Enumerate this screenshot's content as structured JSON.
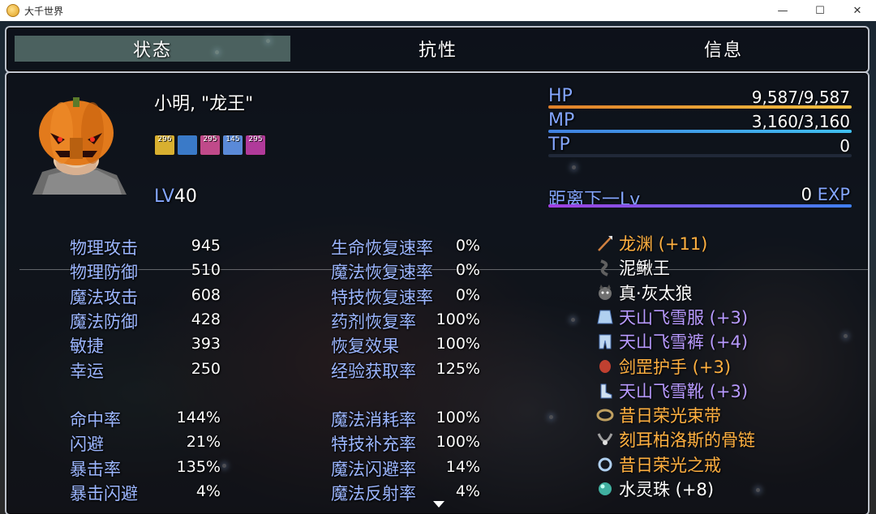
{
  "window": {
    "title": "大千世界"
  },
  "tabs": [
    {
      "label": "状态"
    },
    {
      "label": "抗性"
    },
    {
      "label": "信息"
    }
  ],
  "actor": {
    "name": "小明, \"龙王\"",
    "level_label": "LV",
    "level": "40",
    "states": [
      {
        "icon": "gold-state-icon",
        "turns": "296",
        "color": "#d8b030"
      },
      {
        "icon": "dragon-state-icon",
        "turns": "",
        "color": "#3a7ac8"
      },
      {
        "icon": "pink-state-icon",
        "turns": "295",
        "color": "#c04a8a"
      },
      {
        "icon": "blue-state-icon",
        "turns": "145",
        "color": "#5a8ad8"
      },
      {
        "icon": "magenta-state-icon",
        "turns": "295",
        "color": "#b03a9a"
      }
    ]
  },
  "gauges": {
    "hp": {
      "label": "HP",
      "value": "9,587/9,587",
      "fraction": 1.0,
      "colors": [
        "#e0802a",
        "#f0c040"
      ]
    },
    "mp": {
      "label": "MP",
      "value": "3,160/3,160",
      "fraction": 1.0,
      "colors": [
        "#4080e0",
        "#40c0f0"
      ]
    },
    "tp": {
      "label": "TP",
      "value": "0",
      "fraction": 0.0,
      "colors": [
        "#40c040",
        "#a0f040"
      ]
    },
    "exp": {
      "label": "距离下一Lv",
      "value": "0",
      "unit": "EXP",
      "fraction": 1.0,
      "colors": [
        "#a040e0",
        "#4080f0"
      ]
    }
  },
  "params": [
    {
      "label": "物理攻击",
      "value": "945"
    },
    {
      "label": "物理防御",
      "value": "510"
    },
    {
      "label": "魔法攻击",
      "value": "608"
    },
    {
      "label": "魔法防御",
      "value": "428"
    },
    {
      "label": "敏捷",
      "value": "393"
    },
    {
      "label": "幸运",
      "value": "250"
    }
  ],
  "xparams": [
    {
      "label": "命中率",
      "value": "144%"
    },
    {
      "label": "闪避",
      "value": "21%"
    },
    {
      "label": "暴击率",
      "value": "135%"
    },
    {
      "label": "暴击闪避",
      "value": "4%"
    }
  ],
  "sparams1": [
    {
      "label": "生命恢复速率",
      "value": "0%"
    },
    {
      "label": "魔法恢复速率",
      "value": "0%"
    },
    {
      "label": "特技恢复速率",
      "value": "0%"
    },
    {
      "label": "药剂恢复率",
      "value": "100%"
    },
    {
      "label": "恢复效果",
      "value": "100%"
    },
    {
      "label": "经验获取率",
      "value": "125%"
    }
  ],
  "sparams2": [
    {
      "label": "魔法消耗率",
      "value": "100%"
    },
    {
      "label": "特技补充率",
      "value": "100%"
    },
    {
      "label": "魔法闪避率",
      "value": "14%"
    },
    {
      "label": "魔法反射率",
      "value": "4%"
    }
  ],
  "equips": [
    {
      "icon": "spear-icon",
      "name": "龙渊 (+11)",
      "color": "#ffb040"
    },
    {
      "icon": "eel-icon",
      "name": "泥鳅王",
      "color": "#ffffff"
    },
    {
      "icon": "wolf-icon",
      "name": "真·灰太狼",
      "color": "#ffffff"
    },
    {
      "icon": "robe-icon",
      "name": "天山飞雪服 (+3)",
      "color": "#b89aff"
    },
    {
      "icon": "pants-icon",
      "name": "天山飞雪裤 (+4)",
      "color": "#b89aff"
    },
    {
      "icon": "gauntlet-icon",
      "name": "剑罡护手 (+3)",
      "color": "#ffb040"
    },
    {
      "icon": "boots-icon",
      "name": "天山飞雪靴 (+3)",
      "color": "#b89aff"
    },
    {
      "icon": "belt-icon",
      "name": "昔日荣光束带",
      "color": "#ffb040"
    },
    {
      "icon": "necklace-icon",
      "name": "刻耳柏洛斯的骨链",
      "color": "#ffb040"
    },
    {
      "icon": "ring-icon",
      "name": "昔日荣光之戒",
      "color": "#ffb040"
    },
    {
      "icon": "orb-icon",
      "name": "水灵珠 (+8)",
      "color": "#ffffff"
    }
  ]
}
